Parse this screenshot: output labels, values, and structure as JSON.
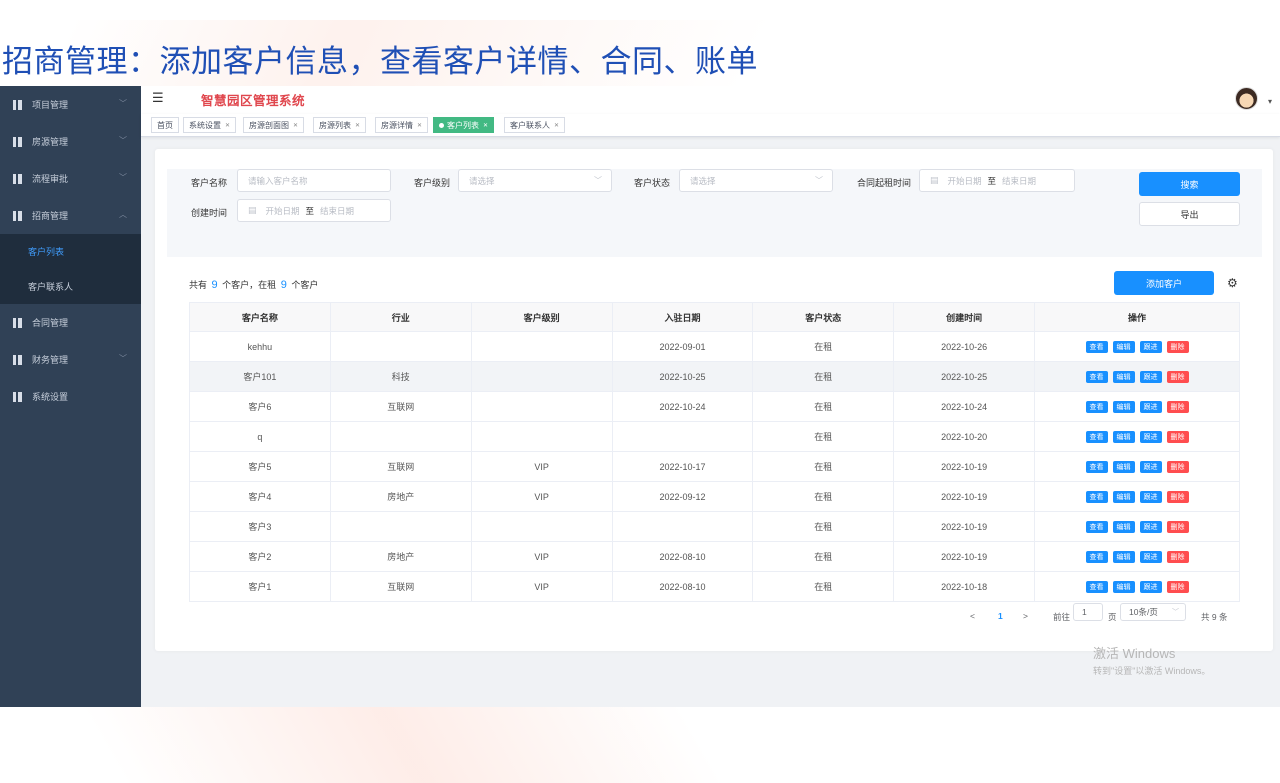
{
  "slide_title": "招商管理：添加客户信息，查看客户详情、合同、账单",
  "app": {
    "system_title": "智慧园区管理系统",
    "hamburger_glyph": "☰",
    "avatar_caret": "▾",
    "sidebar": {
      "items": [
        {
          "label": "项目管理",
          "has_arrow": true
        },
        {
          "label": "房源管理",
          "has_arrow": true
        },
        {
          "label": "流程审批",
          "has_arrow": true
        },
        {
          "label": "招商管理",
          "has_arrow": true,
          "expanded": true
        },
        {
          "label": "合同管理",
          "has_arrow": false
        },
        {
          "label": "财务管理",
          "has_arrow": true
        },
        {
          "label": "系统设置",
          "has_arrow": false
        }
      ],
      "sub_items": [
        {
          "label": "客户列表",
          "active": true
        },
        {
          "label": "客户联系人",
          "active": false
        }
      ]
    },
    "tags": [
      {
        "label": "首页",
        "closable": false,
        "active": false
      },
      {
        "label": "系统设置",
        "closable": true,
        "active": false
      },
      {
        "label": "房源剖面图",
        "closable": true,
        "active": false
      },
      {
        "label": "房源列表",
        "closable": true,
        "active": false
      },
      {
        "label": "房源详情",
        "closable": true,
        "active": false
      },
      {
        "label": "客户列表",
        "closable": true,
        "active": true
      },
      {
        "label": "客户联系人",
        "closable": true,
        "active": false
      }
    ],
    "filters": {
      "customer_name_label": "客户名称",
      "customer_name_placeholder": "请输入客户名称",
      "level_label": "客户级别",
      "level_placeholder": "请选择",
      "status_label": "客户状态",
      "status_placeholder": "请选择",
      "contract_time_label": "合同起租时间",
      "created_time_label": "创建时间",
      "start_placeholder": "开始日期",
      "end_placeholder": "结束日期",
      "range_separator": "至",
      "search_button": "搜索",
      "export_button": "导出"
    },
    "summary": {
      "prefix": "共有",
      "total": "9",
      "middle": "个客户，在租",
      "renting": "9",
      "suffix": "个客户"
    },
    "add_button": "添加客户",
    "table": {
      "columns": [
        "客户名称",
        "行业",
        "客户级别",
        "入驻日期",
        "客户状态",
        "创建时间",
        "操作"
      ],
      "action_labels": {
        "view": "查看",
        "edit": "编辑",
        "follow": "跟进",
        "delete": "删除"
      },
      "rows": [
        {
          "name": "kehhu",
          "industry": "",
          "level": "",
          "checkin": "2022-09-01",
          "status": "在租",
          "created": "2022-10-26"
        },
        {
          "name": "客户101",
          "industry": "科技",
          "level": "",
          "checkin": "2022-10-25",
          "status": "在租",
          "created": "2022-10-25"
        },
        {
          "name": "客户6",
          "industry": "互联网",
          "level": "",
          "checkin": "2022-10-24",
          "status": "在租",
          "created": "2022-10-24"
        },
        {
          "name": "q",
          "industry": "",
          "level": "",
          "checkin": "",
          "status": "在租",
          "created": "2022-10-20"
        },
        {
          "name": "客户5",
          "industry": "互联网",
          "level": "VIP",
          "checkin": "2022-10-17",
          "status": "在租",
          "created": "2022-10-19"
        },
        {
          "name": "客户4",
          "industry": "房地产",
          "level": "VIP",
          "checkin": "2022-09-12",
          "status": "在租",
          "created": "2022-10-19"
        },
        {
          "name": "客户3",
          "industry": "",
          "level": "",
          "checkin": "",
          "status": "在租",
          "created": "2022-10-19"
        },
        {
          "name": "客户2",
          "industry": "房地产",
          "level": "VIP",
          "checkin": "2022-08-10",
          "status": "在租",
          "created": "2022-10-19"
        },
        {
          "name": "客户1",
          "industry": "互联网",
          "level": "VIP",
          "checkin": "2022-08-10",
          "status": "在租",
          "created": "2022-10-18"
        }
      ],
      "highlighted_row": 1
    },
    "pagination": {
      "prev": "<",
      "current_page": "1",
      "next": ">",
      "goto_label": "前往",
      "goto_value": "1",
      "page_unit": "页",
      "page_size": "10条/页",
      "total_text": "共 9 条"
    }
  },
  "watermark": {
    "line1": "激活 Windows",
    "line2": "转到\"设置\"以激活 Windows。"
  }
}
